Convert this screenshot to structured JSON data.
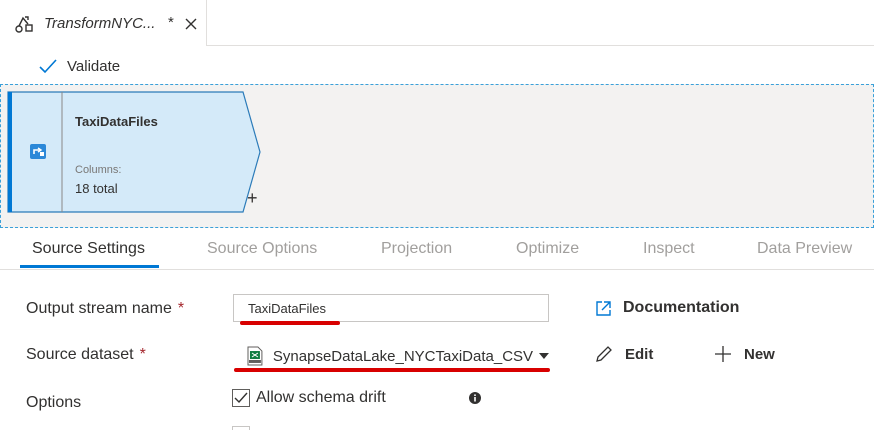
{
  "tab": {
    "title": "TransformNYC...",
    "dirty_marker": "*",
    "icon": "dataflow-icon",
    "close_icon": "close-icon"
  },
  "toolbar": {
    "validate_label": "Validate",
    "validate_icon": "checkmark-icon"
  },
  "node": {
    "title": "TaxiDataFiles",
    "columns_label": "Columns:",
    "columns_value": "18 total",
    "add_label": "+",
    "icon": "source-icon"
  },
  "settings_tabs": [
    {
      "label": "Source Settings",
      "active": true
    },
    {
      "label": "Source Options",
      "active": false
    },
    {
      "label": "Projection",
      "active": false
    },
    {
      "label": "Optimize",
      "active": false
    },
    {
      "label": "Inspect",
      "active": false
    },
    {
      "label": "Data Preview",
      "active": false
    }
  ],
  "form": {
    "output_stream_label": "Output stream name",
    "output_stream_value": "TaxiDataFiles",
    "source_dataset_label": "Source dataset",
    "source_dataset_value": "SynapseDataLake_NYCTaxiData_CSV",
    "options_label": "Options",
    "required_marker": "*",
    "allow_schema_drift_label": "Allow schema drift",
    "allow_schema_drift_checked": true
  },
  "actions": {
    "documentation_label": "Documentation",
    "edit_label": "Edit",
    "new_label": "New"
  },
  "colors": {
    "accent": "#0078d4",
    "node_fill": "#d4eaf9",
    "annotation_red": "#d80000",
    "required_red": "#a4262c"
  }
}
